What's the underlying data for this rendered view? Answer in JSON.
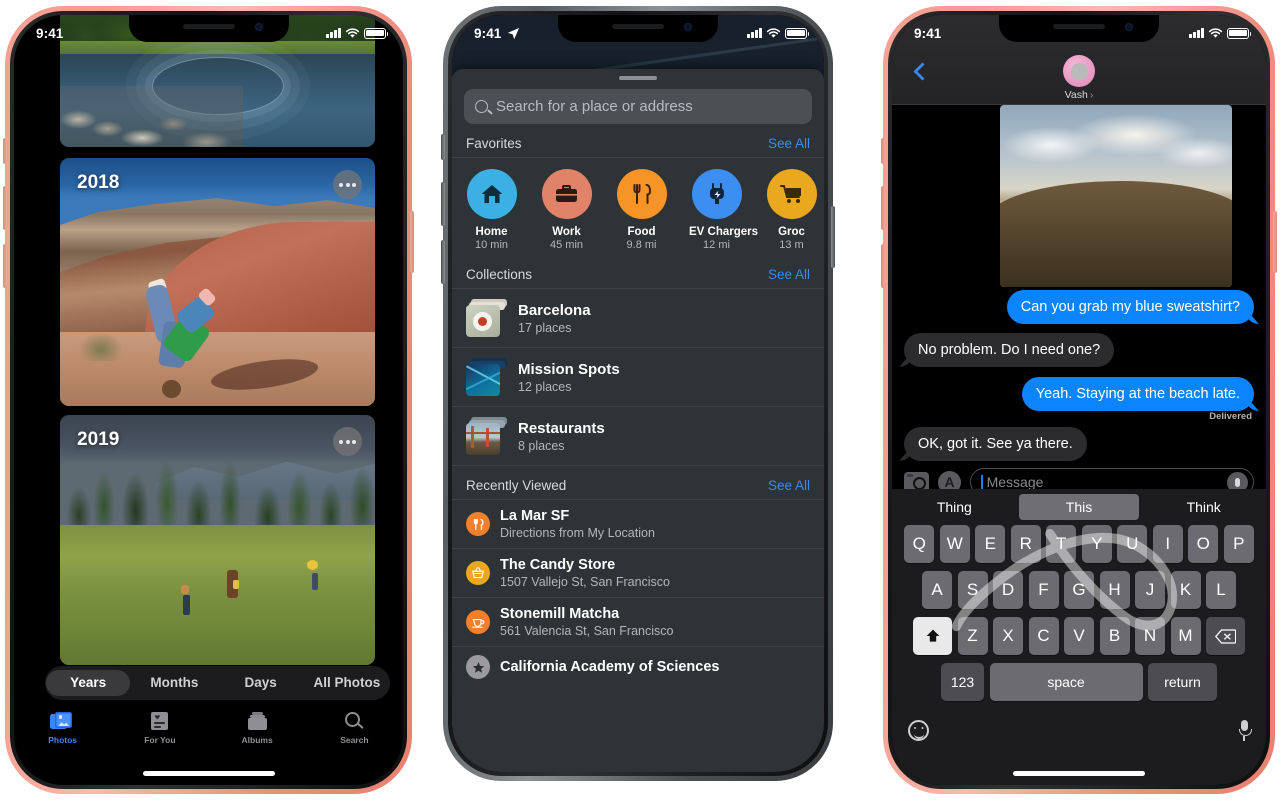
{
  "scene": {
    "description": "Three iPhone devices side by side showing Photos, Maps and Messages apps in dark mode"
  },
  "colors": {
    "coral_frame": "#f49d90",
    "graphite_frame": "#585d61",
    "ios_blue": "#0b84fe",
    "link_blue": "#3a8cf0",
    "maps_sheet": "#2d3336",
    "bubble_gray": "#2c2c2e"
  },
  "phone1": {
    "device_name": "iPhone Photos",
    "frame_color": "coral",
    "status_bar": {
      "time": "9:41",
      "signal_icon": "cellular-bars-icon",
      "wifi_icon": "wifi-icon",
      "battery_icon": "battery-icon"
    },
    "app": "Photos",
    "cards": [
      {
        "label": "",
        "scene": "lake-ripple-photo",
        "more_button": false
      },
      {
        "label": "2018",
        "scene": "painted-hills-handstand-photo",
        "more_button": true
      },
      {
        "label": "2019",
        "scene": "mountain-meadow-kids-photo",
        "more_button": true
      }
    ],
    "segmented_control": {
      "selected": "Years",
      "options": [
        "Years",
        "Months",
        "Days",
        "All Photos"
      ]
    },
    "tab_bar": {
      "selected": "Photos",
      "items": [
        {
          "label": "Photos",
          "icon": "photos-stack-icon"
        },
        {
          "label": "For You",
          "icon": "for-you-card-icon"
        },
        {
          "label": "Albums",
          "icon": "albums-box-icon"
        },
        {
          "label": "Search",
          "icon": "search-icon"
        }
      ]
    }
  },
  "phone2": {
    "device_name": "iPhone Maps",
    "frame_color": "graphite",
    "status_bar": {
      "time": "9:41",
      "location_icon": "location-arrow-icon",
      "signal_icon": "cellular-bars-icon",
      "wifi_icon": "wifi-icon",
      "battery_icon": "battery-icon"
    },
    "app": "Maps",
    "search": {
      "placeholder": "Search for a place or address",
      "icon": "search-icon",
      "value": ""
    },
    "favorites": {
      "title": "Favorites",
      "see_all": "See All",
      "items": [
        {
          "label": "Home",
          "detail": "10 min",
          "icon": "house-icon",
          "color": "#3cb0e5"
        },
        {
          "label": "Work",
          "detail": "45 min",
          "icon": "briefcase-icon",
          "color": "#e08368"
        },
        {
          "label": "Food",
          "detail": "9.8 mi",
          "icon": "fork-knife-icon",
          "color": "#f79428"
        },
        {
          "label": "EV Chargers",
          "detail": "12 mi",
          "icon": "ev-plug-icon",
          "color": "#3c8ef0"
        },
        {
          "label": "Groc",
          "detail": "13 m",
          "icon": "shopping-cart-icon",
          "color": "#eaa81f"
        }
      ]
    },
    "collections": {
      "title": "Collections",
      "see_all": "See All",
      "items": [
        {
          "name": "Barcelona",
          "detail": "17 places",
          "thumb": "food-plate-photo"
        },
        {
          "name": "Mission Spots",
          "detail": "12 places",
          "thumb": "blue-abstract-photo"
        },
        {
          "name": "Restaurants",
          "detail": "8 places",
          "thumb": "golden-gate-bridge-photo"
        }
      ]
    },
    "recently_viewed": {
      "title": "Recently Viewed",
      "see_all": "See All",
      "items": [
        {
          "name": "La Mar SF",
          "detail": "Directions from My Location",
          "icon": "fork-knife-icon",
          "color": "#f2802b"
        },
        {
          "name": "The Candy Store",
          "detail": "1507 Vallejo St, San Francisco",
          "icon": "shopping-basket-icon",
          "color": "#eaa81f"
        },
        {
          "name": "Stonemill Matcha",
          "detail": "561 Valencia St, San Francisco",
          "icon": "coffee-cup-icon",
          "color": "#f2802b"
        },
        {
          "name": "California Academy of Sciences",
          "detail": "",
          "icon": "star-icon",
          "color": "#9a9a9f"
        }
      ]
    }
  },
  "phone3": {
    "device_name": "iPhone Messages",
    "frame_color": "coral",
    "status_bar": {
      "time": "9:41",
      "signal_icon": "cellular-bars-icon",
      "wifi_icon": "wifi-icon",
      "battery_icon": "battery-icon"
    },
    "app": "Messages",
    "nav": {
      "back_icon": "chevron-left-icon",
      "contact_name": "Vash",
      "disclosure": "›",
      "avatar": "memoji-avatar"
    },
    "attachment": {
      "type": "photo",
      "scene": "dune-sunset-photo"
    },
    "messages": [
      {
        "from": "me",
        "text": "Can you grab my blue sweatshirt?"
      },
      {
        "from": "them",
        "text": "No problem. Do I need one?"
      },
      {
        "from": "me",
        "text": "Yeah. Staying at the beach late.",
        "status": "Delivered"
      },
      {
        "from": "them",
        "text": "OK, got it. See ya there."
      }
    ],
    "input": {
      "camera_icon": "camera-icon",
      "apps_icon": "app-store-icon",
      "placeholder": "Message",
      "value": "",
      "mic_icon": "microphone-icon"
    },
    "keyboard": {
      "predictions": [
        "Thing",
        "This",
        "Think"
      ],
      "prediction_selected": "This",
      "rows": [
        [
          "Q",
          "W",
          "E",
          "R",
          "T",
          "Y",
          "U",
          "I",
          "O",
          "P"
        ],
        [
          "A",
          "S",
          "D",
          "F",
          "G",
          "H",
          "J",
          "K",
          "L"
        ],
        [
          "Z",
          "X",
          "C",
          "V",
          "B",
          "N",
          "M"
        ]
      ],
      "shift_icon": "shift-arrow-icon",
      "delete_icon": "delete-backspace-icon",
      "numbers_key": "123",
      "space_key": "space",
      "return_key": "return",
      "emoji_icon": "emoji-smiley-icon",
      "dictation_icon": "microphone-icon",
      "swipe_trail": "quickpath-gesture-trail"
    }
  }
}
